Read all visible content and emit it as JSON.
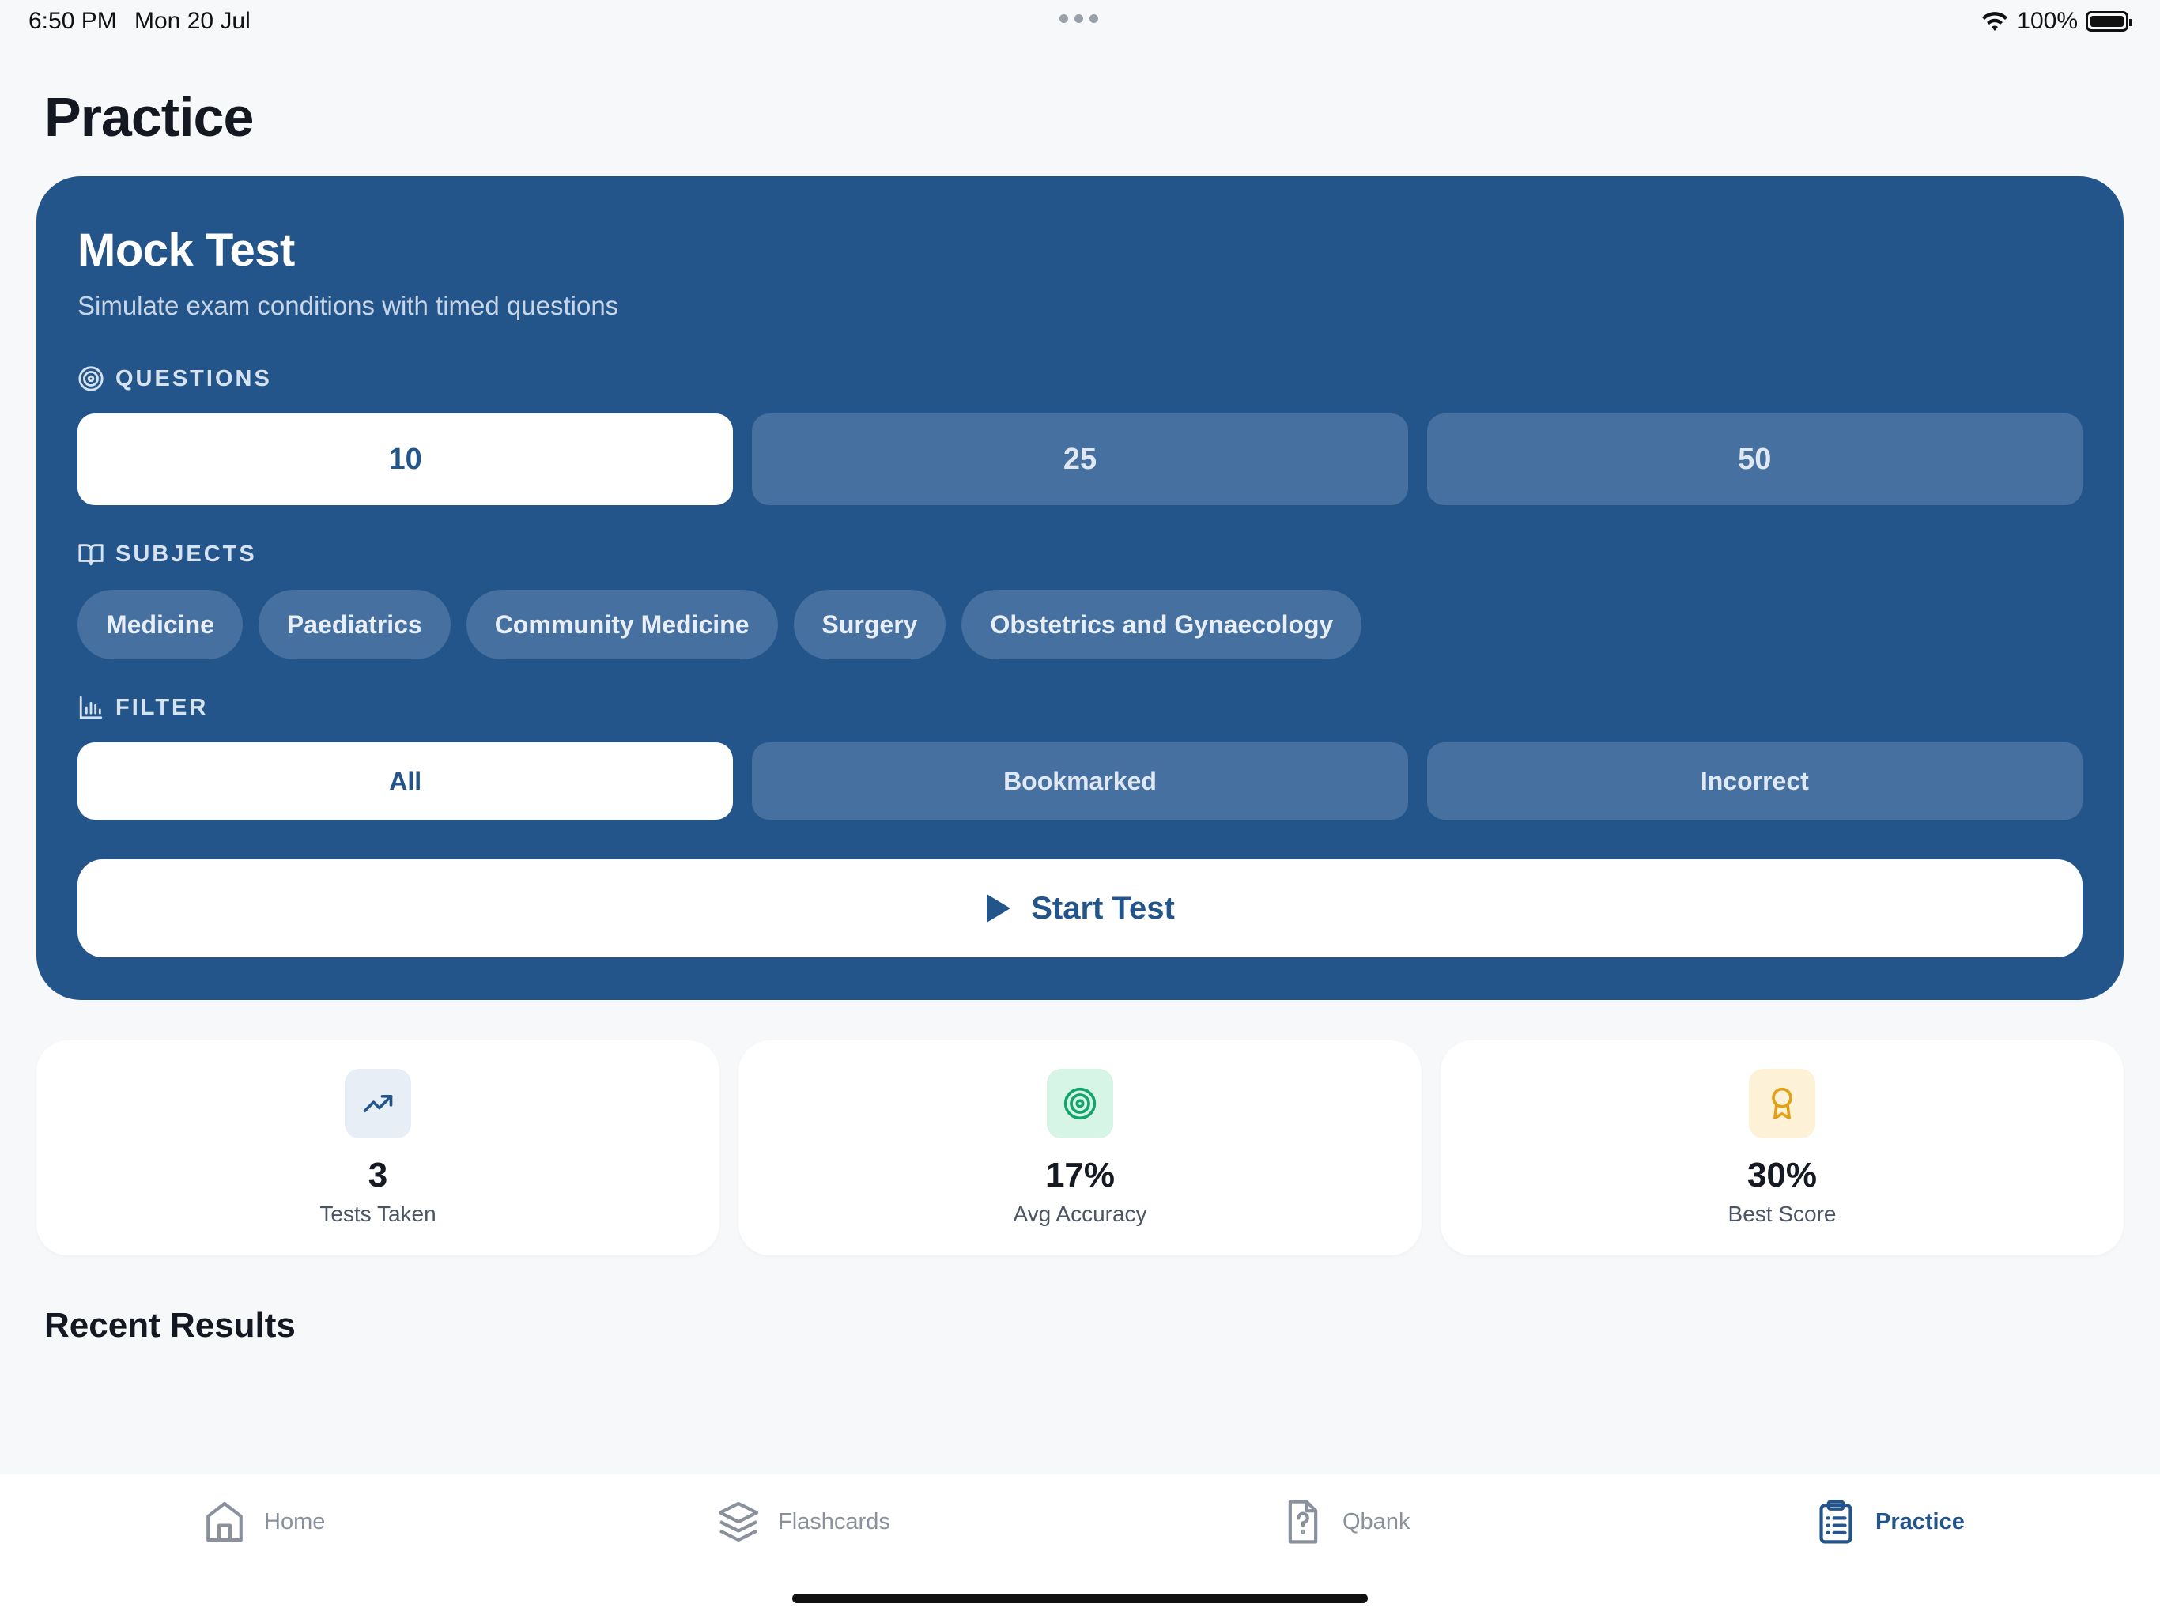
{
  "status_bar": {
    "time": "6:50 PM",
    "date": "Mon 20 Jul",
    "battery": "100%"
  },
  "page": {
    "title": "Practice"
  },
  "mock_test": {
    "title": "Mock Test",
    "subtitle": "Simulate exam conditions with timed questions",
    "questions_label": "QUESTIONS",
    "question_options": [
      "10",
      "25",
      "50"
    ],
    "selected_question_option": "10",
    "subjects_label": "SUBJECTS",
    "subjects": [
      "Medicine",
      "Paediatrics",
      "Community Medicine",
      "Surgery",
      "Obstetrics and Gynaecology"
    ],
    "filter_label": "FILTER",
    "filter_options": [
      "All",
      "Bookmarked",
      "Incorrect"
    ],
    "selected_filter": "All",
    "start_label": "Start Test"
  },
  "stats": [
    {
      "value": "3",
      "label": "Tests Taken",
      "icon": "trending-up-icon",
      "icon_bg": "#e8eef6",
      "icon_color": "#23558a"
    },
    {
      "value": "17%",
      "label": "Avg Accuracy",
      "icon": "target-icon",
      "icon_bg": "#d6f5e6",
      "icon_color": "#14a36b"
    },
    {
      "value": "30%",
      "label": "Best Score",
      "icon": "award-icon",
      "icon_bg": "#fdf1d8",
      "icon_color": "#e2a114"
    }
  ],
  "recent": {
    "title": "Recent Results"
  },
  "tabs": [
    {
      "label": "Home",
      "icon": "home-icon",
      "active": false
    },
    {
      "label": "Flashcards",
      "icon": "layers-icon",
      "active": false
    },
    {
      "label": "Qbank",
      "icon": "question-file-icon",
      "active": false
    },
    {
      "label": "Practice",
      "icon": "clipboard-list-icon",
      "active": true
    }
  ],
  "colors": {
    "primary": "#23558a",
    "segment_inactive": "#45709f",
    "background": "#f7f8fa"
  }
}
